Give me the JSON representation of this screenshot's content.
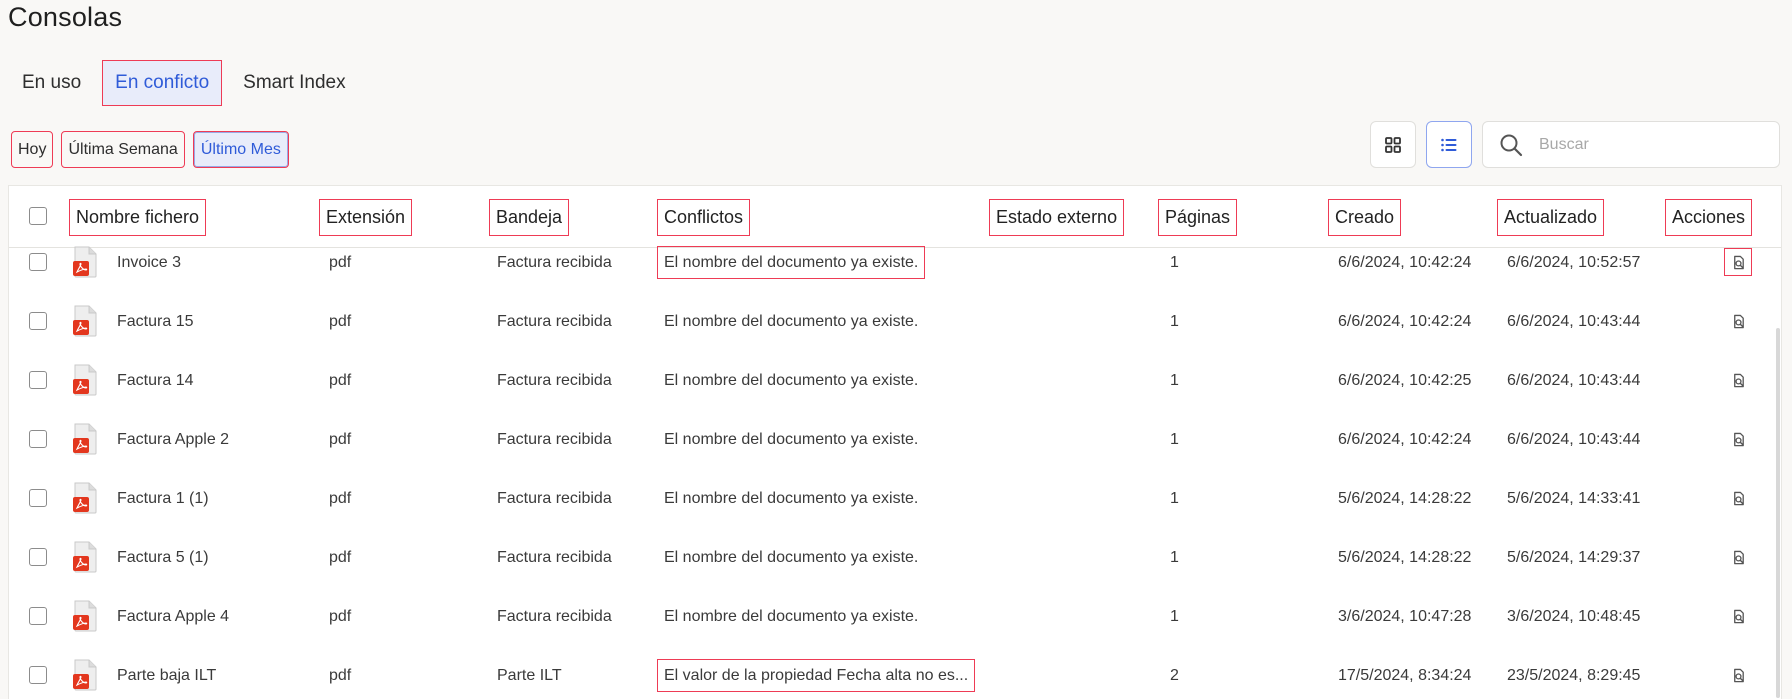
{
  "page": {
    "title": "Consolas"
  },
  "tabs": [
    {
      "label": "En uso",
      "active": false
    },
    {
      "label": "En conficto",
      "active": true
    },
    {
      "label": "Smart Index",
      "active": false
    }
  ],
  "date_ranges": [
    {
      "label": "Hoy",
      "active": false
    },
    {
      "label": "Última Semana",
      "active": false
    },
    {
      "label": "Último Mes",
      "active": true
    }
  ],
  "view_toggle": {
    "selected": "list",
    "options": [
      "grid",
      "list"
    ]
  },
  "search": {
    "placeholder": "Buscar",
    "value": ""
  },
  "colors": {
    "accent": "#2f5bd8",
    "accent_bg": "#e8ecfa",
    "pdf_red": "#e3371e",
    "highlight": "#ee3b55"
  },
  "table": {
    "columns": {
      "name": "Nombre fichero",
      "extension": "Extensión",
      "tray": "Bandeja",
      "conflicts": "Conflictos",
      "external_status": "Estado externo",
      "pages": "Páginas",
      "created": "Creado",
      "updated": "Actualizado",
      "actions": "Acciones"
    },
    "rows": [
      {
        "name": "Invoice 3",
        "extension": "pdf",
        "tray": "Factura recibida",
        "conflict": "El nombre del documento ya existe.",
        "external_status": "",
        "pages": "1",
        "created": "6/6/2024, 10:42:24",
        "updated": "6/6/2024, 10:52:57",
        "icon": "pdf-file-icon",
        "action_icon": "view-document-icon"
      },
      {
        "name": "Factura 15",
        "extension": "pdf",
        "tray": "Factura recibida",
        "conflict": "El nombre del documento ya existe.",
        "external_status": "",
        "pages": "1",
        "created": "6/6/2024, 10:42:24",
        "updated": "6/6/2024, 10:43:44",
        "icon": "pdf-file-icon",
        "action_icon": "view-document-icon"
      },
      {
        "name": "Factura 14",
        "extension": "pdf",
        "tray": "Factura recibida",
        "conflict": "El nombre del documento ya existe.",
        "external_status": "",
        "pages": "1",
        "created": "6/6/2024, 10:42:25",
        "updated": "6/6/2024, 10:43:44",
        "icon": "pdf-file-icon",
        "action_icon": "view-document-icon"
      },
      {
        "name": "Factura Apple 2",
        "extension": "pdf",
        "tray": "Factura recibida",
        "conflict": "El nombre del documento ya existe.",
        "external_status": "",
        "pages": "1",
        "created": "6/6/2024, 10:42:24",
        "updated": "6/6/2024, 10:43:44",
        "icon": "pdf-file-icon",
        "action_icon": "view-document-icon"
      },
      {
        "name": "Factura 1 (1)",
        "extension": "pdf",
        "tray": "Factura recibida",
        "conflict": "El nombre del documento ya existe.",
        "external_status": "",
        "pages": "1",
        "created": "5/6/2024, 14:28:22",
        "updated": "5/6/2024, 14:33:41",
        "icon": "pdf-file-icon",
        "action_icon": "view-document-icon"
      },
      {
        "name": "Factura 5 (1)",
        "extension": "pdf",
        "tray": "Factura recibida",
        "conflict": "El nombre del documento ya existe.",
        "external_status": "",
        "pages": "1",
        "created": "5/6/2024, 14:28:22",
        "updated": "5/6/2024, 14:29:37",
        "icon": "pdf-file-icon",
        "action_icon": "view-document-icon"
      },
      {
        "name": "Factura Apple 4",
        "extension": "pdf",
        "tray": "Factura recibida",
        "conflict": "El nombre del documento ya existe.",
        "external_status": "",
        "pages": "1",
        "created": "3/6/2024, 10:47:28",
        "updated": "3/6/2024, 10:48:45",
        "icon": "pdf-file-icon",
        "action_icon": "view-document-icon"
      },
      {
        "name": "Parte baja ILT",
        "extension": "pdf",
        "tray": "Parte ILT",
        "conflict": "El valor de la propiedad Fecha alta no es...",
        "external_status": "",
        "pages": "2",
        "created": "17/5/2024, 8:34:24",
        "updated": "23/5/2024, 8:29:45",
        "icon": "pdf-file-icon",
        "action_icon": "view-document-icon"
      }
    ]
  }
}
